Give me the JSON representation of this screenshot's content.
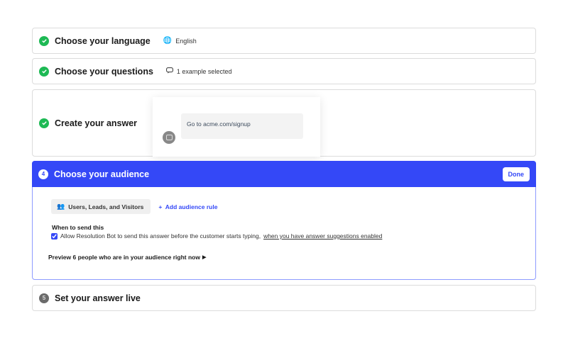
{
  "steps": [
    {
      "title": "Choose your language",
      "meta": "English",
      "icon": "globe-icon"
    },
    {
      "title": "Choose your questions",
      "meta": "1 example selected",
      "icon": "chat-bubble-icon"
    },
    {
      "title": "Create your answer",
      "answer_text": "Go to acme.com/signup"
    },
    {
      "number": "4",
      "title": "Choose your audience",
      "done_label": "Done",
      "audience_chip": "Users, Leads, and Visitors",
      "add_rule": "Add audience rule",
      "when_heading": "When to send this",
      "checkbox_label": "Allow Resolution Bot to send this answer before the customer starts typing,",
      "checkbox_link": "when you have answer suggestions enabled",
      "checkbox_checked": true,
      "preview": "Preview 6 people who are in your audience right now"
    },
    {
      "number": "5",
      "title": "Set your answer live"
    }
  ],
  "colors": {
    "accent": "#3448f7",
    "success": "#1db954"
  }
}
